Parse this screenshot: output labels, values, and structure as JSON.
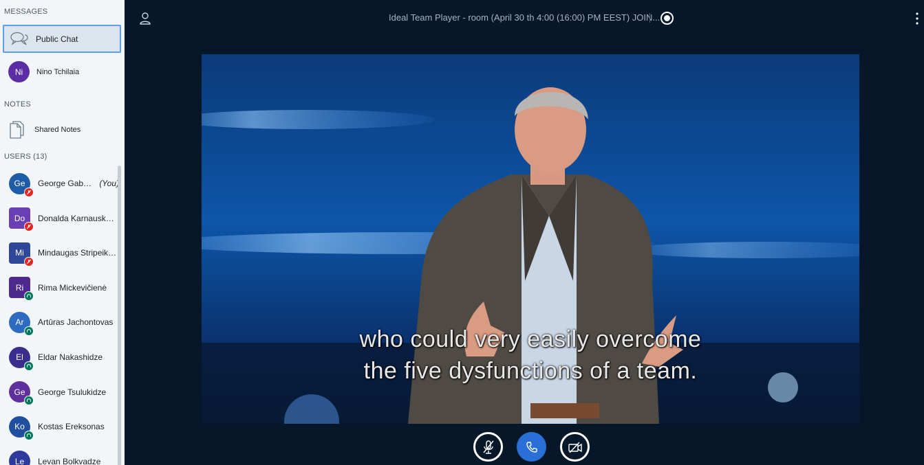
{
  "sidebar": {
    "messages_title": "MESSAGES",
    "public_chat": "Public Chat",
    "private_chat": {
      "initials": "Ni",
      "name": "Nino Tchilaia",
      "color": "#5b2ea6"
    },
    "notes_title": "NOTES",
    "shared_notes": "Shared Notes",
    "users_title": "USERS (13)",
    "users": [
      {
        "initials": "Ge",
        "name": "George Gabe…",
        "you": "(You)",
        "color": "#1f5ca8",
        "shape": "circle",
        "status": "muted"
      },
      {
        "initials": "Do",
        "name": "Donalda Karnausk…",
        "color": "#6a3fb3",
        "shape": "square",
        "status": "muted"
      },
      {
        "initials": "Mi",
        "name": "Mindaugas Stripeik…",
        "color": "#2f4798",
        "shape": "square",
        "status": "muted"
      },
      {
        "initials": "Ri",
        "name": "Rima Mickevičienė",
        "color": "#4e2a8f",
        "shape": "square",
        "status": "listen"
      },
      {
        "initials": "Ar",
        "name": "Artūras Jachontovas",
        "color": "#2d6bc0",
        "shape": "circle",
        "status": "listen"
      },
      {
        "initials": "El",
        "name": "Eldar Nakashidze",
        "color": "#3b2c8f",
        "shape": "circle",
        "status": "listen"
      },
      {
        "initials": "Ge",
        "name": "George Tsulukidze",
        "color": "#5f2f9e",
        "shape": "circle",
        "status": "listen"
      },
      {
        "initials": "Ko",
        "name": "Kostas Ereksonas",
        "color": "#1f4f9e",
        "shape": "circle",
        "status": "listen"
      },
      {
        "initials": "Le",
        "name": "Levan Bolkvadze",
        "color": "#2e3a9e",
        "shape": "circle",
        "status": "listen"
      }
    ]
  },
  "header": {
    "title": "Ideal Team Player - room (April 30 th 4:00 (16:00) PM EEST) JOIN..."
  },
  "video": {
    "caption_line1": "who could very easily overcome",
    "caption_line2": "the five dysfunctions of a team."
  },
  "controls": {
    "audio": "mic-muted-icon",
    "leave_audio": "phone-icon",
    "camera": "camera-off-icon",
    "accent": "#2a6fd6"
  }
}
